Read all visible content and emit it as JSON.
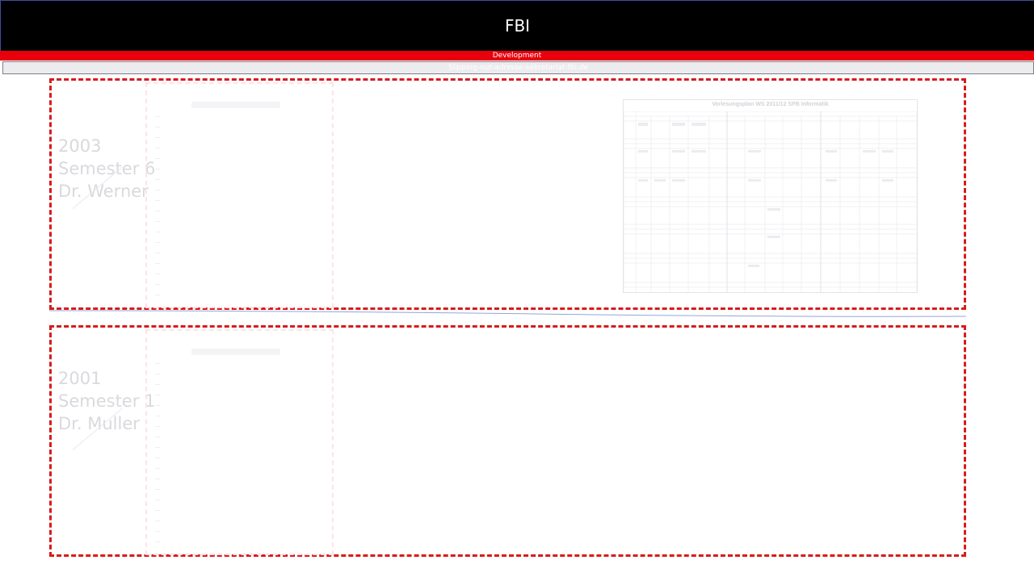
{
  "header": {
    "title": "FBI",
    "environment_label": "Development",
    "url_text": "Slipping-out-adresse-sekretariat-fbi.de"
  },
  "cards": [
    {
      "year": "2003",
      "semester": "Semester 6",
      "lecturer": "Dr. Werner",
      "has_schedule": true
    },
    {
      "year": "2001",
      "semester": "Semester 1",
      "lecturer": "Dr. Muller",
      "has_schedule": false
    }
  ],
  "schedule": {
    "title": "Vorlesungsplan WS 2011/12     SPB   Informatik"
  },
  "colors": {
    "header_bg": "#000000",
    "dev_bar": "#e8000d",
    "card_border": "#d61c1c",
    "faded_text": "#d9d9de"
  }
}
